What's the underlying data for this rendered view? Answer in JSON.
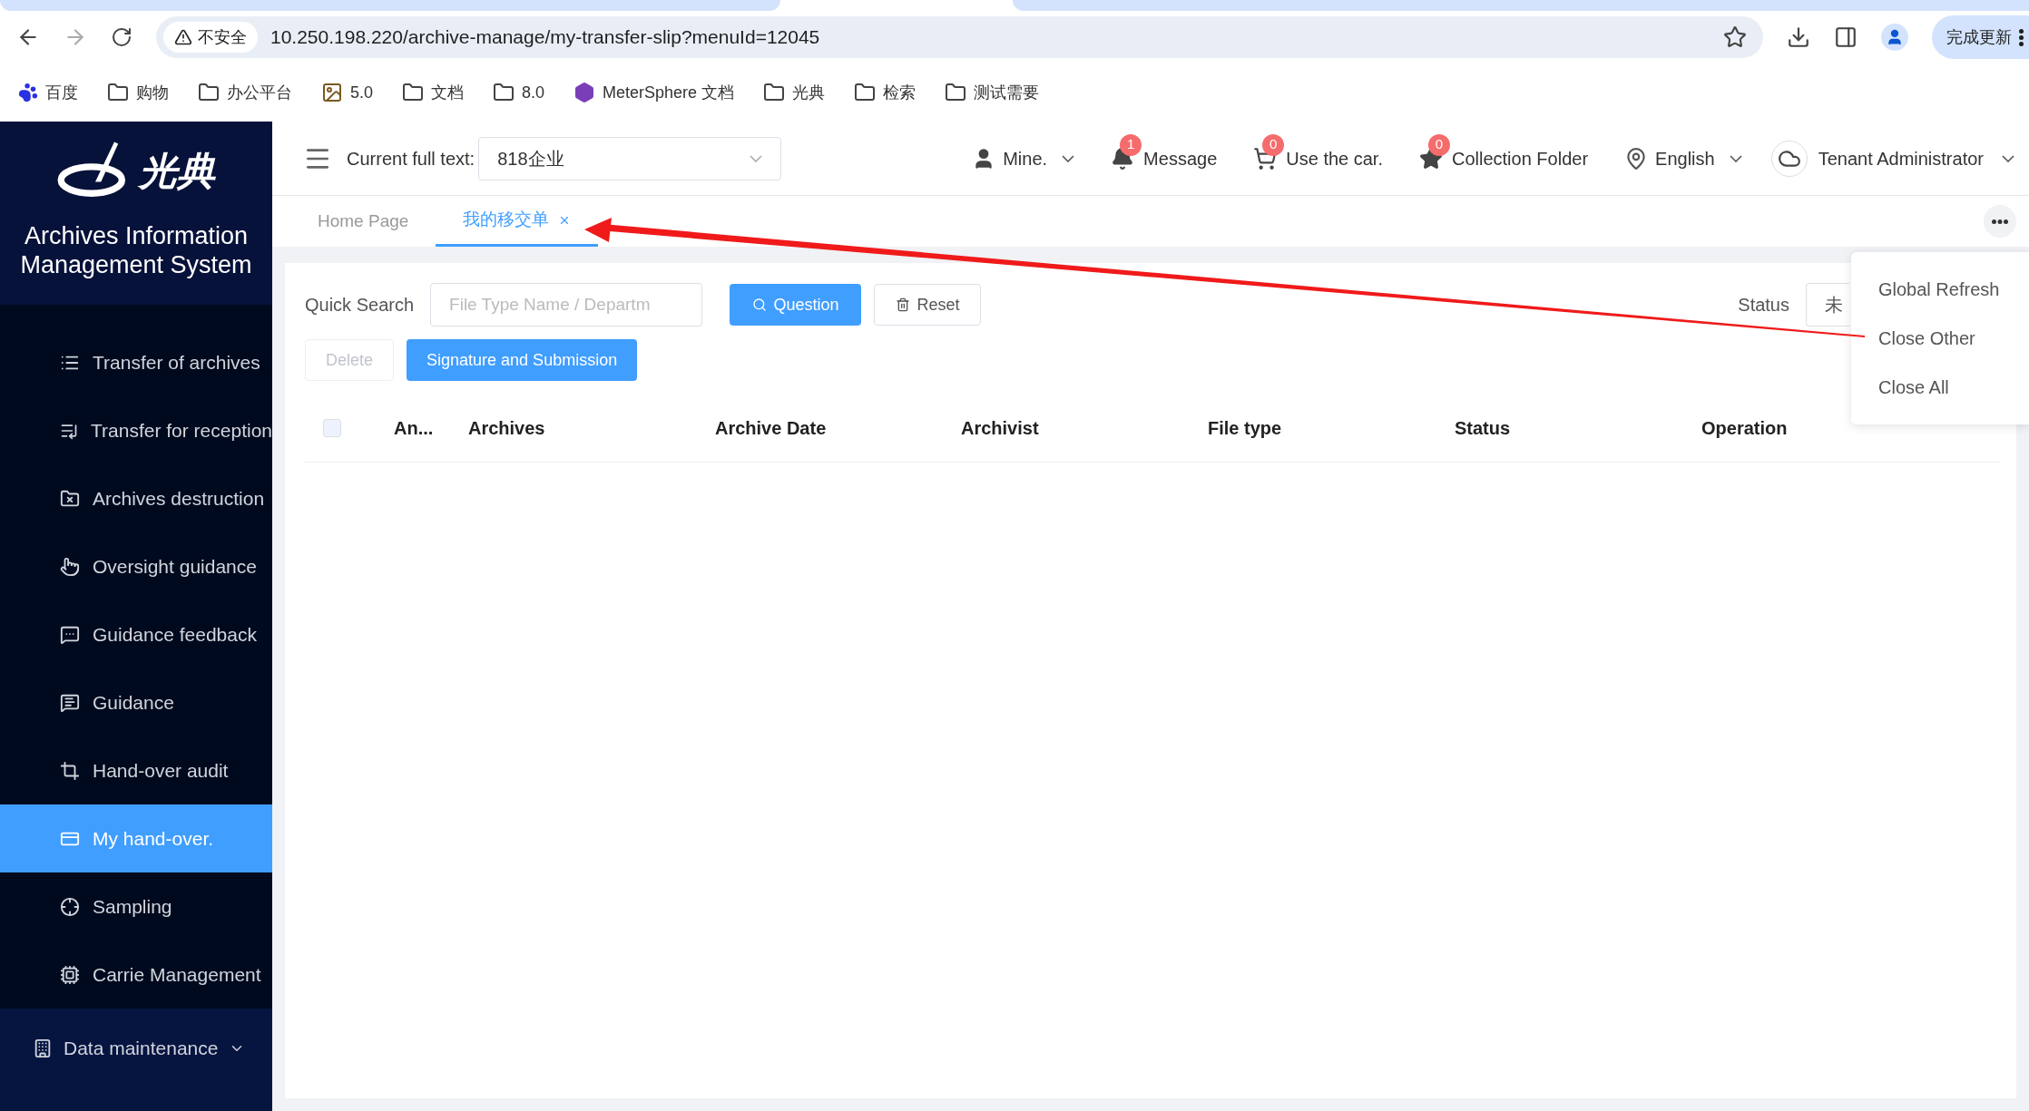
{
  "browser": {
    "address": {
      "security_label": "不安全",
      "url": "10.250.198.220/archive-manage/my-transfer-slip?menuId=12045"
    },
    "update_button": "完成更新",
    "bookmarks": [
      {
        "label": "百度",
        "kind": "paw"
      },
      {
        "label": "购物",
        "kind": "folder"
      },
      {
        "label": "办公平台",
        "kind": "folder"
      },
      {
        "label": "5.0",
        "kind": "image"
      },
      {
        "label": "文档",
        "kind": "folder"
      },
      {
        "label": "8.0",
        "kind": "folder"
      },
      {
        "label": "MeterSphere 文档",
        "kind": "app"
      },
      {
        "label": "光典",
        "kind": "folder"
      },
      {
        "label": "检索",
        "kind": "folder"
      },
      {
        "label": "测试需要",
        "kind": "folder"
      }
    ]
  },
  "sidebar": {
    "logo_text": "光典",
    "title": "Archives Information Management System",
    "items": [
      {
        "label": "Transfer of archives",
        "selected": false
      },
      {
        "label": "Transfer for reception",
        "selected": false
      },
      {
        "label": "Archives destruction",
        "selected": false
      },
      {
        "label": "Oversight guidance",
        "selected": false
      },
      {
        "label": "Guidance feedback",
        "selected": false
      },
      {
        "label": "Guidance",
        "selected": false
      },
      {
        "label": "Hand-over audit",
        "selected": false
      },
      {
        "label": "My hand-over.",
        "selected": true
      },
      {
        "label": "Sampling",
        "selected": false
      },
      {
        "label": "Carrie Management",
        "selected": false
      }
    ],
    "group": {
      "label": "Data maintenance"
    }
  },
  "header": {
    "full_text_label": "Current full text:",
    "full_text_value": "818企业",
    "user": "Mine.",
    "notices": [
      {
        "label": "Message",
        "badge": "1"
      },
      {
        "label": "Use the car.",
        "badge": "0"
      },
      {
        "label": "Collection Folder",
        "badge": "0"
      }
    ],
    "language": "English",
    "tenant": "Tenant Administrator"
  },
  "tabs": [
    {
      "label": "Home Page",
      "selected": false,
      "closable": false
    },
    {
      "label": "我的移交单",
      "selected": true,
      "closable": true
    }
  ],
  "tab_menu": [
    "Global Refresh",
    "Close Other",
    "Close All"
  ],
  "search": {
    "label": "Quick Search",
    "placeholder": "File Type Name / Departm",
    "buttons": [
      {
        "label": "Question",
        "kind": "primary"
      },
      {
        "label": "Reset",
        "kind": "default"
      }
    ],
    "status_label": "Status",
    "status_value": "未"
  },
  "actions": [
    {
      "label": "Delete",
      "disabled": true
    },
    {
      "label": "Signature and Submission",
      "disabled": false
    }
  ],
  "table": {
    "all_checked": false,
    "columns": [
      "An...",
      "Archives",
      "Archive Date",
      "Archivist",
      "File type",
      "Status",
      "Operation"
    ]
  }
}
